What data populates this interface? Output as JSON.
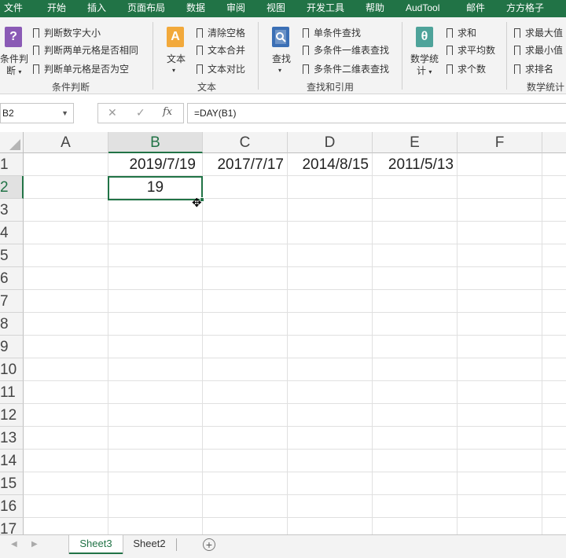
{
  "menu": {
    "tabs": [
      "文件",
      "开始",
      "插入",
      "页面布局",
      "数据",
      "审阅",
      "视图",
      "开发工具",
      "帮助",
      "AudTool",
      "邮件",
      "方方格子"
    ]
  },
  "ribbon": {
    "cond": {
      "big_label_1": "条件判",
      "big_label_2": "断",
      "items": [
        "判断数字大小",
        "判断两单元格是否相同",
        "判断单元格是否为空"
      ],
      "group": "条件判断",
      "icon_text": "?"
    },
    "text": {
      "big_label": "文本",
      "items": [
        "清除空格",
        "文本合并",
        "文本对比"
      ],
      "group": "文本",
      "icon_text": "A"
    },
    "lookup": {
      "big_label": "查找",
      "items": [
        "单条件查找",
        "多条件一维表查找",
        "多条件二维表查找"
      ],
      "group": "查找和引用"
    },
    "math": {
      "big_label_1": "数学统",
      "big_label_2": "计",
      "items": [
        "求和",
        "求平均数",
        "求个数"
      ],
      "icon_text": "θ"
    },
    "stats": {
      "items": [
        "求最大值",
        "求最小值",
        "求排名"
      ],
      "group": "数学统计"
    }
  },
  "formula_bar": {
    "name_box": "B2",
    "cancel_icon": "✕",
    "enter_icon": "✓",
    "fx": "fx",
    "formula": "=DAY(B1)"
  },
  "grid": {
    "columns": [
      "A",
      "B",
      "C",
      "D",
      "E",
      "F"
    ],
    "rows": [
      "1",
      "2",
      "3",
      "4",
      "5",
      "6",
      "7",
      "8",
      "9",
      "10",
      "11",
      "12",
      "13",
      "14",
      "15",
      "16",
      "17"
    ],
    "cells": {
      "B1": "2019/7/19",
      "C1": "2017/7/17",
      "D1": "2014/8/15",
      "E1": "2011/5/13",
      "B2": "19"
    },
    "selected_cell": "B2"
  },
  "sheets": {
    "tabs": [
      "Sheet3",
      "Sheet2"
    ],
    "active": "Sheet3",
    "add": "+"
  },
  "colors": {
    "accent": "#217346",
    "ribbon_bg": "#f3f3f3"
  }
}
